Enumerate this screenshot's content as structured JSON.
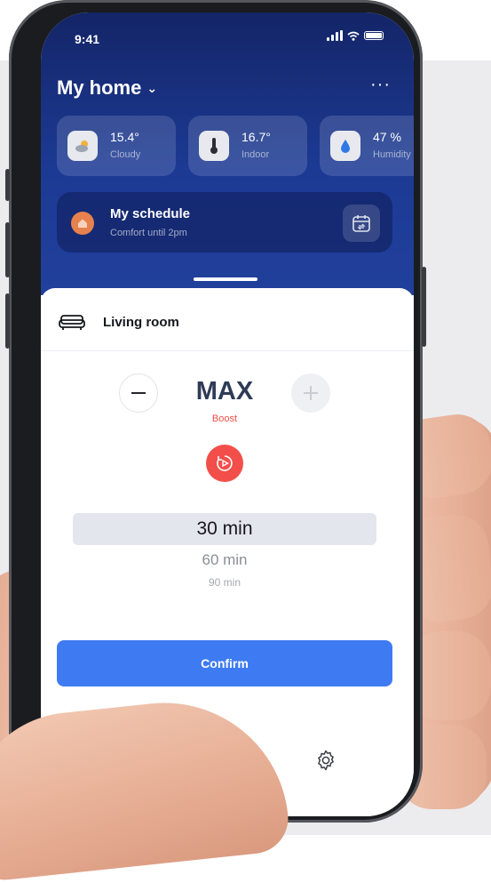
{
  "status_bar": {
    "time": "9:41"
  },
  "header": {
    "title": "My home",
    "more_glyph": "···"
  },
  "weather_cards": [
    {
      "value": "15.4°",
      "label": "Cloudy",
      "icon": "cloud-sun-icon"
    },
    {
      "value": "16.7°",
      "label": "Indoor",
      "icon": "thermometer-icon"
    },
    {
      "value": "47 %",
      "label": "Humidity",
      "icon": "droplet-icon"
    }
  ],
  "schedule": {
    "title": "My schedule",
    "subtitle": "Comfort until 2pm"
  },
  "room": {
    "label": "Living room"
  },
  "mode": {
    "value": "MAX",
    "sub": "Boost"
  },
  "picker": {
    "options": [
      "30 min",
      "60 min",
      "90 min"
    ],
    "selected": "30 min"
  },
  "actions": {
    "confirm": "Confirm"
  },
  "colors": {
    "header_bg": "#1c3a94",
    "accent": "#3e7bf2",
    "boost": "#f24f4a"
  }
}
